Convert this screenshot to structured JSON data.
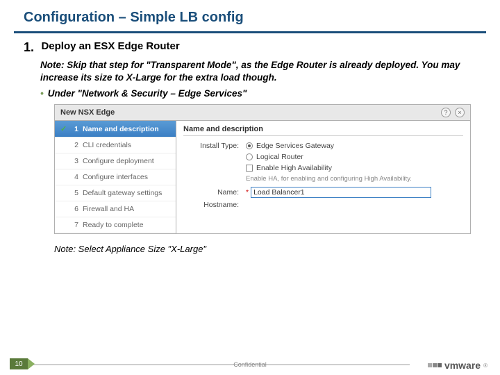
{
  "slide": {
    "title": "Configuration – Simple LB config",
    "step_number": "1.",
    "step_title": "Deploy an ESX Edge Router",
    "note1": "Note: Skip that step for \"Transparent Mode\", as the Edge Router is already deployed. You may increase its size to X-Large for the extra load though.",
    "bullet1": "Under \"Network & Security – Edge Services\"",
    "note2": "Note: Select Appliance Size \"X-Large\""
  },
  "wizard": {
    "header_title": "New NSX Edge",
    "help_icon": "?",
    "close_icon": "×",
    "steps": [
      {
        "num": "1",
        "label": "Name and description",
        "active": true,
        "done": true
      },
      {
        "num": "2",
        "label": "CLI credentials"
      },
      {
        "num": "3",
        "label": "Configure deployment"
      },
      {
        "num": "4",
        "label": "Configure interfaces"
      },
      {
        "num": "5",
        "label": "Default gateway settings"
      },
      {
        "num": "6",
        "label": "Firewall and HA"
      },
      {
        "num": "7",
        "label": "Ready to complete"
      }
    ],
    "main": {
      "section_title": "Name and description",
      "install_type_label": "Install Type:",
      "opt_gateway": "Edge Services Gateway",
      "opt_router": "Logical Router",
      "enable_ha": "Enable High Availability",
      "ha_hint": "Enable HA, for enabling and configuring High Availability.",
      "name_label": "Name:",
      "name_value": "Load Balancer1",
      "hostname_label": "Hostname:"
    }
  },
  "footer": {
    "page": "10",
    "confidential": "Confidential",
    "logo_text": "vmware",
    "reg": "®"
  }
}
